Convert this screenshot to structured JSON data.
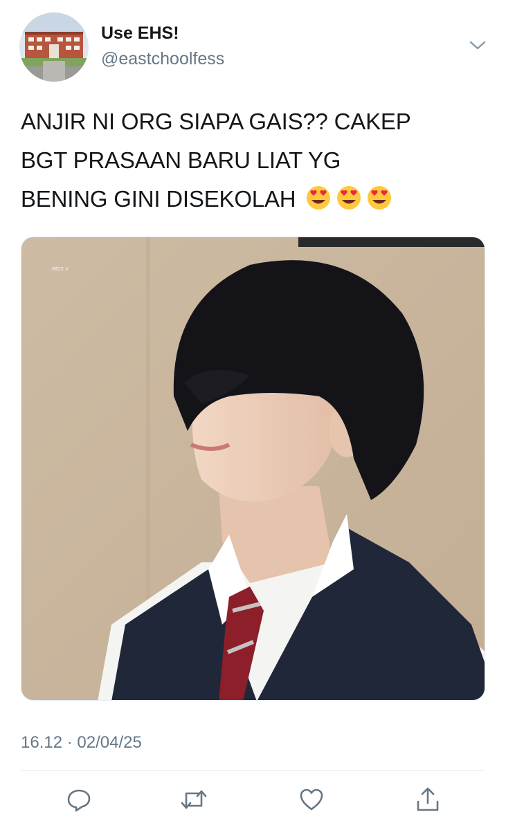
{
  "author": {
    "display_name": "Use EHS!",
    "handle": "@eastchoolfess",
    "avatar_icon": "school-building-avatar"
  },
  "tweet": {
    "lines": [
      "ANJIR NI ORG SIAPA GAIS?? CAKEP",
      "BGT PRASAAN BARU LIAT YG",
      "BENING GINI DISEKOLAH"
    ],
    "emoji": [
      "heart-eyes-emoji",
      "heart-eyes-emoji",
      "heart-eyes-emoji"
    ],
    "media": {
      "watermark": "atoz v",
      "description_icon": "photo-of-student-in-school-uniform"
    },
    "timestamp": "16.12 · 02/04/25"
  },
  "actions": [
    {
      "name": "reply",
      "icon": "reply-icon"
    },
    {
      "name": "retweet",
      "icon": "retweet-icon"
    },
    {
      "name": "like",
      "icon": "heart-icon"
    },
    {
      "name": "share",
      "icon": "share-icon"
    }
  ],
  "colors": {
    "text": "#14171a",
    "secondary": "#657786",
    "divider": "#e1e8ed"
  }
}
